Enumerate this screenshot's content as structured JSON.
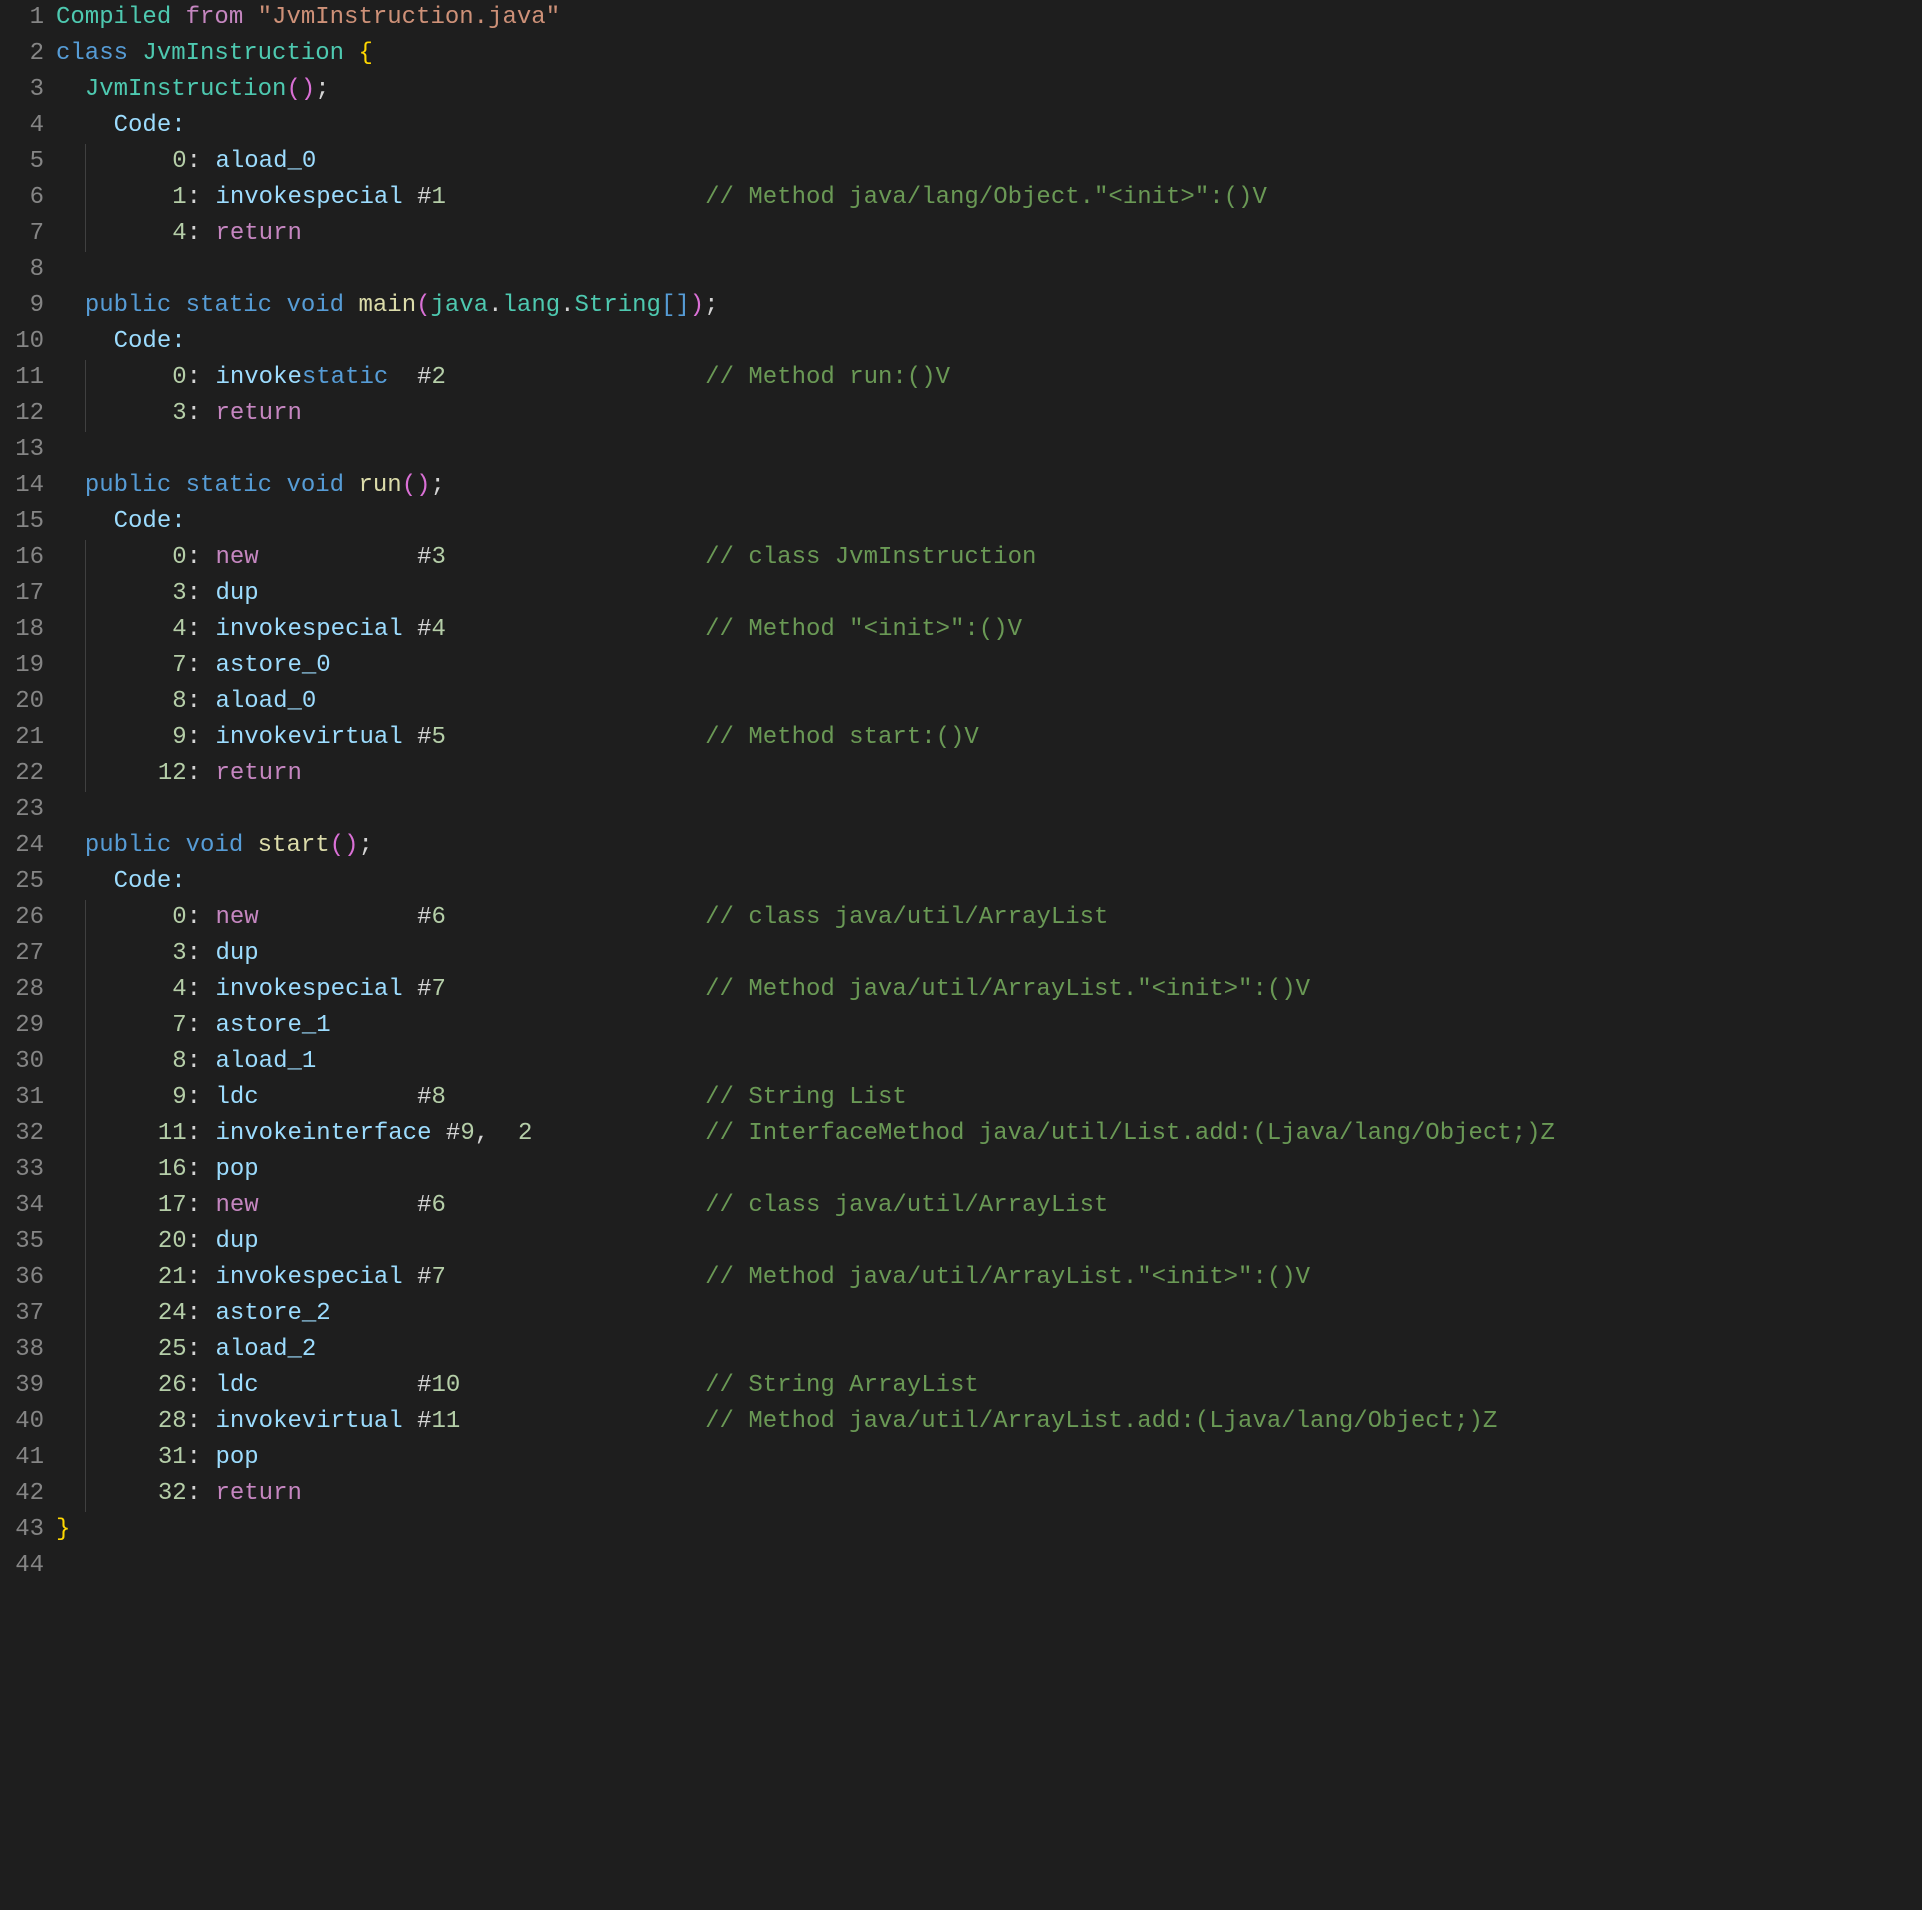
{
  "lineCount": 44,
  "lines": [
    {
      "indent": 0,
      "segs": [
        {
          "cls": "tk-type",
          "t": "Compiled"
        },
        {
          "cls": "",
          "t": " "
        },
        {
          "cls": "tk-kw2",
          "t": "from"
        },
        {
          "cls": "",
          "t": " "
        },
        {
          "cls": "tk-str",
          "t": "\"JvmInstruction.java\""
        }
      ]
    },
    {
      "indent": 0,
      "segs": [
        {
          "cls": "tk-kw",
          "t": "class"
        },
        {
          "cls": "",
          "t": " "
        },
        {
          "cls": "tk-type",
          "t": "JvmInstruction"
        },
        {
          "cls": "",
          "t": " "
        },
        {
          "cls": "tk-punc",
          "t": "{"
        }
      ]
    },
    {
      "indent": 1,
      "segs": [
        {
          "cls": "tk-type",
          "t": "JvmInstruction"
        },
        {
          "cls": "tk-parens",
          "t": "()"
        },
        {
          "cls": "",
          "t": ";"
        }
      ]
    },
    {
      "indent": 1,
      "segs": [
        {
          "cls": "",
          "t": "  "
        },
        {
          "cls": "tk-label",
          "t": "Code:"
        }
      ]
    },
    {
      "indent": 1,
      "guide": true,
      "segs": [
        {
          "cls": "",
          "t": "    "
        },
        {
          "cls": "tk-num",
          "t": " 0"
        },
        {
          "cls": "",
          "t": ": "
        },
        {
          "cls": "tk-var",
          "t": "aload_0"
        }
      ]
    },
    {
      "indent": 1,
      "guide": true,
      "segs": [
        {
          "cls": "",
          "t": "    "
        },
        {
          "cls": "tk-num",
          "t": " 1"
        },
        {
          "cls": "",
          "t": ": "
        },
        {
          "cls": "tk-var",
          "t": "invokespecial"
        },
        {
          "cls": "",
          "t": " #"
        },
        {
          "cls": "tk-num",
          "t": "1"
        },
        {
          "cls": "",
          "t": "                  "
        },
        {
          "cls": "tk-comm",
          "t": "// Method java/lang/Object.\"<init>\":()V"
        }
      ]
    },
    {
      "indent": 1,
      "guide": true,
      "segs": [
        {
          "cls": "",
          "t": "    "
        },
        {
          "cls": "tk-num",
          "t": " 4"
        },
        {
          "cls": "",
          "t": ": "
        },
        {
          "cls": "tk-kw2",
          "t": "return"
        }
      ]
    },
    {
      "indent": 0,
      "segs": []
    },
    {
      "indent": 1,
      "segs": [
        {
          "cls": "tk-kw",
          "t": "public"
        },
        {
          "cls": "",
          "t": " "
        },
        {
          "cls": "tk-kw",
          "t": "static"
        },
        {
          "cls": "",
          "t": " "
        },
        {
          "cls": "tk-kw",
          "t": "void"
        },
        {
          "cls": "",
          "t": " "
        },
        {
          "cls": "tk-func",
          "t": "main"
        },
        {
          "cls": "tk-parens",
          "t": "("
        },
        {
          "cls": "tk-type",
          "t": "java"
        },
        {
          "cls": "",
          "t": "."
        },
        {
          "cls": "tk-type",
          "t": "lang"
        },
        {
          "cls": "",
          "t": "."
        },
        {
          "cls": "tk-type",
          "t": "String"
        },
        {
          "cls": "tk-kw",
          "t": "[]"
        },
        {
          "cls": "tk-parens",
          "t": ")"
        },
        {
          "cls": "",
          "t": ";"
        }
      ]
    },
    {
      "indent": 1,
      "segs": [
        {
          "cls": "",
          "t": "  "
        },
        {
          "cls": "tk-label",
          "t": "Code:"
        }
      ]
    },
    {
      "indent": 1,
      "guide": true,
      "segs": [
        {
          "cls": "",
          "t": "    "
        },
        {
          "cls": "tk-num",
          "t": " 0"
        },
        {
          "cls": "",
          "t": ": "
        },
        {
          "cls": "tk-var",
          "t": "invoke"
        },
        {
          "cls": "tk-kw",
          "t": "static"
        },
        {
          "cls": "",
          "t": "  #"
        },
        {
          "cls": "tk-num",
          "t": "2"
        },
        {
          "cls": "",
          "t": "                  "
        },
        {
          "cls": "tk-comm",
          "t": "// Method run:()V"
        }
      ]
    },
    {
      "indent": 1,
      "guide": true,
      "segs": [
        {
          "cls": "",
          "t": "    "
        },
        {
          "cls": "tk-num",
          "t": " 3"
        },
        {
          "cls": "",
          "t": ": "
        },
        {
          "cls": "tk-kw2",
          "t": "return"
        }
      ]
    },
    {
      "indent": 0,
      "segs": []
    },
    {
      "indent": 1,
      "segs": [
        {
          "cls": "tk-kw",
          "t": "public"
        },
        {
          "cls": "",
          "t": " "
        },
        {
          "cls": "tk-kw",
          "t": "static"
        },
        {
          "cls": "",
          "t": " "
        },
        {
          "cls": "tk-kw",
          "t": "void"
        },
        {
          "cls": "",
          "t": " "
        },
        {
          "cls": "tk-func",
          "t": "run"
        },
        {
          "cls": "tk-parens",
          "t": "()"
        },
        {
          "cls": "",
          "t": ";"
        }
      ]
    },
    {
      "indent": 1,
      "segs": [
        {
          "cls": "",
          "t": "  "
        },
        {
          "cls": "tk-label",
          "t": "Code:"
        }
      ]
    },
    {
      "indent": 1,
      "guide": true,
      "segs": [
        {
          "cls": "",
          "t": "    "
        },
        {
          "cls": "tk-num",
          "t": " 0"
        },
        {
          "cls": "",
          "t": ": "
        },
        {
          "cls": "tk-kw2",
          "t": "new"
        },
        {
          "cls": "",
          "t": "           #"
        },
        {
          "cls": "tk-num",
          "t": "3"
        },
        {
          "cls": "",
          "t": "                  "
        },
        {
          "cls": "tk-comm",
          "t": "// class JvmInstruction"
        }
      ]
    },
    {
      "indent": 1,
      "guide": true,
      "segs": [
        {
          "cls": "",
          "t": "    "
        },
        {
          "cls": "tk-num",
          "t": " 3"
        },
        {
          "cls": "",
          "t": ": "
        },
        {
          "cls": "tk-var",
          "t": "dup"
        }
      ]
    },
    {
      "indent": 1,
      "guide": true,
      "segs": [
        {
          "cls": "",
          "t": "    "
        },
        {
          "cls": "tk-num",
          "t": " 4"
        },
        {
          "cls": "",
          "t": ": "
        },
        {
          "cls": "tk-var",
          "t": "invokespecial"
        },
        {
          "cls": "",
          "t": " #"
        },
        {
          "cls": "tk-num",
          "t": "4"
        },
        {
          "cls": "",
          "t": "                  "
        },
        {
          "cls": "tk-comm",
          "t": "// Method \"<init>\":()V"
        }
      ]
    },
    {
      "indent": 1,
      "guide": true,
      "segs": [
        {
          "cls": "",
          "t": "    "
        },
        {
          "cls": "tk-num",
          "t": " 7"
        },
        {
          "cls": "",
          "t": ": "
        },
        {
          "cls": "tk-var",
          "t": "astore_0"
        }
      ]
    },
    {
      "indent": 1,
      "guide": true,
      "segs": [
        {
          "cls": "",
          "t": "    "
        },
        {
          "cls": "tk-num",
          "t": " 8"
        },
        {
          "cls": "",
          "t": ": "
        },
        {
          "cls": "tk-var",
          "t": "aload_0"
        }
      ]
    },
    {
      "indent": 1,
      "guide": true,
      "segs": [
        {
          "cls": "",
          "t": "    "
        },
        {
          "cls": "tk-num",
          "t": " 9"
        },
        {
          "cls": "",
          "t": ": "
        },
        {
          "cls": "tk-var",
          "t": "invokevirtual"
        },
        {
          "cls": "",
          "t": " #"
        },
        {
          "cls": "tk-num",
          "t": "5"
        },
        {
          "cls": "",
          "t": "                  "
        },
        {
          "cls": "tk-comm",
          "t": "// Method start:()V"
        }
      ]
    },
    {
      "indent": 1,
      "guide": true,
      "segs": [
        {
          "cls": "",
          "t": "    "
        },
        {
          "cls": "tk-num",
          "t": "12"
        },
        {
          "cls": "",
          "t": ": "
        },
        {
          "cls": "tk-kw2",
          "t": "return"
        }
      ]
    },
    {
      "indent": 0,
      "segs": []
    },
    {
      "indent": 1,
      "segs": [
        {
          "cls": "tk-kw",
          "t": "public"
        },
        {
          "cls": "",
          "t": " "
        },
        {
          "cls": "tk-kw",
          "t": "void"
        },
        {
          "cls": "",
          "t": " "
        },
        {
          "cls": "tk-func",
          "t": "start"
        },
        {
          "cls": "tk-parens",
          "t": "()"
        },
        {
          "cls": "",
          "t": ";"
        }
      ]
    },
    {
      "indent": 1,
      "segs": [
        {
          "cls": "",
          "t": "  "
        },
        {
          "cls": "tk-label",
          "t": "Code:"
        }
      ]
    },
    {
      "indent": 1,
      "guide": true,
      "segs": [
        {
          "cls": "",
          "t": "    "
        },
        {
          "cls": "tk-num",
          "t": " 0"
        },
        {
          "cls": "",
          "t": ": "
        },
        {
          "cls": "tk-kw2",
          "t": "new"
        },
        {
          "cls": "",
          "t": "           #"
        },
        {
          "cls": "tk-num",
          "t": "6"
        },
        {
          "cls": "",
          "t": "                  "
        },
        {
          "cls": "tk-comm",
          "t": "// class java/util/ArrayList"
        }
      ]
    },
    {
      "indent": 1,
      "guide": true,
      "segs": [
        {
          "cls": "",
          "t": "    "
        },
        {
          "cls": "tk-num",
          "t": " 3"
        },
        {
          "cls": "",
          "t": ": "
        },
        {
          "cls": "tk-var",
          "t": "dup"
        }
      ]
    },
    {
      "indent": 1,
      "guide": true,
      "segs": [
        {
          "cls": "",
          "t": "    "
        },
        {
          "cls": "tk-num",
          "t": " 4"
        },
        {
          "cls": "",
          "t": ": "
        },
        {
          "cls": "tk-var",
          "t": "invokespecial"
        },
        {
          "cls": "",
          "t": " #"
        },
        {
          "cls": "tk-num",
          "t": "7"
        },
        {
          "cls": "",
          "t": "                  "
        },
        {
          "cls": "tk-comm",
          "t": "// Method java/util/ArrayList.\"<init>\":()V"
        }
      ]
    },
    {
      "indent": 1,
      "guide": true,
      "segs": [
        {
          "cls": "",
          "t": "    "
        },
        {
          "cls": "tk-num",
          "t": " 7"
        },
        {
          "cls": "",
          "t": ": "
        },
        {
          "cls": "tk-var",
          "t": "astore_1"
        }
      ]
    },
    {
      "indent": 1,
      "guide": true,
      "segs": [
        {
          "cls": "",
          "t": "    "
        },
        {
          "cls": "tk-num",
          "t": " 8"
        },
        {
          "cls": "",
          "t": ": "
        },
        {
          "cls": "tk-var",
          "t": "aload_1"
        }
      ]
    },
    {
      "indent": 1,
      "guide": true,
      "segs": [
        {
          "cls": "",
          "t": "    "
        },
        {
          "cls": "tk-num",
          "t": " 9"
        },
        {
          "cls": "",
          "t": ": "
        },
        {
          "cls": "tk-var",
          "t": "ldc"
        },
        {
          "cls": "",
          "t": "           #"
        },
        {
          "cls": "tk-num",
          "t": "8"
        },
        {
          "cls": "",
          "t": "                  "
        },
        {
          "cls": "tk-comm",
          "t": "// String List"
        }
      ]
    },
    {
      "indent": 1,
      "guide": true,
      "segs": [
        {
          "cls": "",
          "t": "    "
        },
        {
          "cls": "tk-num",
          "t": "11"
        },
        {
          "cls": "",
          "t": ": "
        },
        {
          "cls": "tk-var",
          "t": "invokeinterface"
        },
        {
          "cls": "",
          "t": " #"
        },
        {
          "cls": "tk-num",
          "t": "9"
        },
        {
          "cls": "",
          "t": ",  "
        },
        {
          "cls": "tk-num",
          "t": "2"
        },
        {
          "cls": "",
          "t": "            "
        },
        {
          "cls": "tk-comm",
          "t": "// InterfaceMethod java/util/List.add:(Ljava/lang/Object;)Z"
        }
      ]
    },
    {
      "indent": 1,
      "guide": true,
      "segs": [
        {
          "cls": "",
          "t": "    "
        },
        {
          "cls": "tk-num",
          "t": "16"
        },
        {
          "cls": "",
          "t": ": "
        },
        {
          "cls": "tk-var",
          "t": "pop"
        }
      ]
    },
    {
      "indent": 1,
      "guide": true,
      "segs": [
        {
          "cls": "",
          "t": "    "
        },
        {
          "cls": "tk-num",
          "t": "17"
        },
        {
          "cls": "",
          "t": ": "
        },
        {
          "cls": "tk-kw2",
          "t": "new"
        },
        {
          "cls": "",
          "t": "           #"
        },
        {
          "cls": "tk-num",
          "t": "6"
        },
        {
          "cls": "",
          "t": "                  "
        },
        {
          "cls": "tk-comm",
          "t": "// class java/util/ArrayList"
        }
      ]
    },
    {
      "indent": 1,
      "guide": true,
      "segs": [
        {
          "cls": "",
          "t": "    "
        },
        {
          "cls": "tk-num",
          "t": "20"
        },
        {
          "cls": "",
          "t": ": "
        },
        {
          "cls": "tk-var",
          "t": "dup"
        }
      ]
    },
    {
      "indent": 1,
      "guide": true,
      "segs": [
        {
          "cls": "",
          "t": "    "
        },
        {
          "cls": "tk-num",
          "t": "21"
        },
        {
          "cls": "",
          "t": ": "
        },
        {
          "cls": "tk-var",
          "t": "invokespecial"
        },
        {
          "cls": "",
          "t": " #"
        },
        {
          "cls": "tk-num",
          "t": "7"
        },
        {
          "cls": "",
          "t": "                  "
        },
        {
          "cls": "tk-comm",
          "t": "// Method java/util/ArrayList.\"<init>\":()V"
        }
      ]
    },
    {
      "indent": 1,
      "guide": true,
      "segs": [
        {
          "cls": "",
          "t": "    "
        },
        {
          "cls": "tk-num",
          "t": "24"
        },
        {
          "cls": "",
          "t": ": "
        },
        {
          "cls": "tk-var",
          "t": "astore_2"
        }
      ]
    },
    {
      "indent": 1,
      "guide": true,
      "segs": [
        {
          "cls": "",
          "t": "    "
        },
        {
          "cls": "tk-num",
          "t": "25"
        },
        {
          "cls": "",
          "t": ": "
        },
        {
          "cls": "tk-var",
          "t": "aload_2"
        }
      ]
    },
    {
      "indent": 1,
      "guide": true,
      "segs": [
        {
          "cls": "",
          "t": "    "
        },
        {
          "cls": "tk-num",
          "t": "26"
        },
        {
          "cls": "",
          "t": ": "
        },
        {
          "cls": "tk-var",
          "t": "ldc"
        },
        {
          "cls": "",
          "t": "           #"
        },
        {
          "cls": "tk-num",
          "t": "10"
        },
        {
          "cls": "",
          "t": "                 "
        },
        {
          "cls": "tk-comm",
          "t": "// String ArrayList"
        }
      ]
    },
    {
      "indent": 1,
      "guide": true,
      "segs": [
        {
          "cls": "",
          "t": "    "
        },
        {
          "cls": "tk-num",
          "t": "28"
        },
        {
          "cls": "",
          "t": ": "
        },
        {
          "cls": "tk-var",
          "t": "invokevirtual"
        },
        {
          "cls": "",
          "t": " #"
        },
        {
          "cls": "tk-num",
          "t": "11"
        },
        {
          "cls": "",
          "t": "                 "
        },
        {
          "cls": "tk-comm",
          "t": "// Method java/util/ArrayList.add:(Ljava/lang/Object;)Z"
        }
      ]
    },
    {
      "indent": 1,
      "guide": true,
      "segs": [
        {
          "cls": "",
          "t": "    "
        },
        {
          "cls": "tk-num",
          "t": "31"
        },
        {
          "cls": "",
          "t": ": "
        },
        {
          "cls": "tk-var",
          "t": "pop"
        }
      ]
    },
    {
      "indent": 1,
      "guide": true,
      "segs": [
        {
          "cls": "",
          "t": "    "
        },
        {
          "cls": "tk-num",
          "t": "32"
        },
        {
          "cls": "",
          "t": ": "
        },
        {
          "cls": "tk-kw2",
          "t": "return"
        }
      ]
    },
    {
      "indent": 0,
      "segs": [
        {
          "cls": "tk-punc",
          "t": "}"
        }
      ]
    },
    {
      "indent": 0,
      "segs": []
    }
  ]
}
